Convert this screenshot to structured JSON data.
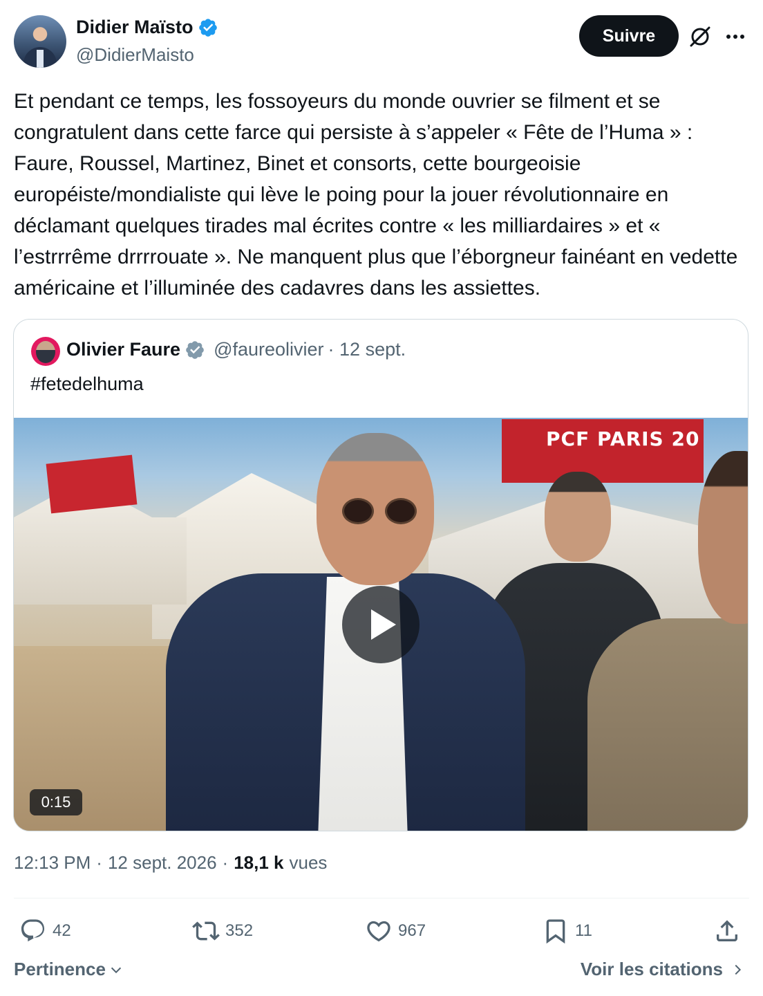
{
  "author": {
    "name": "Didier Maïsto",
    "handle": "@DidierMaisto",
    "verified": true
  },
  "follow_label": "Suivre",
  "tweet_text": "Et pendant ce temps, les fossoyeurs du monde ouvrier se filment et se congratulent dans cette farce qui persiste à s’appeler « Fête de l’Huma » : Faure, Roussel, Martinez, Binet et consorts, cette bourgeoisie européiste/mondialiste qui lève le poing pour la jouer révolutionnaire en déclamant quelques tirades mal écrites contre « les milliardaires » et « l’estrrrême drrrrouate ». Ne manquent plus que l’éborgneur fainéant en vedette américaine et l’illuminée des cadavres dans les assiettes.",
  "quoted": {
    "name": "Olivier Faure",
    "handle": "@faureolivier",
    "date": "· 12 sept.",
    "text": "#fetedelhuma",
    "video_duration": "0:15",
    "video_banner": "PCF PARIS 20"
  },
  "meta": {
    "time": "12:13 PM",
    "sep1": "·",
    "date": "12 sept. 2026",
    "sep2": "·",
    "views_count": "18,1 k",
    "views_label": "vues"
  },
  "actions": {
    "replies": "42",
    "retweets": "352",
    "likes": "967",
    "bookmarks": "11"
  },
  "footer": {
    "sort_label": "Pertinence",
    "quotes_label": "Voir les citations"
  },
  "colors": {
    "text_primary": "#0f1419",
    "text_secondary": "#536471",
    "verified_blue": "#1d9bf0",
    "verified_gray": "#829aab",
    "border": "#cfd9de"
  }
}
